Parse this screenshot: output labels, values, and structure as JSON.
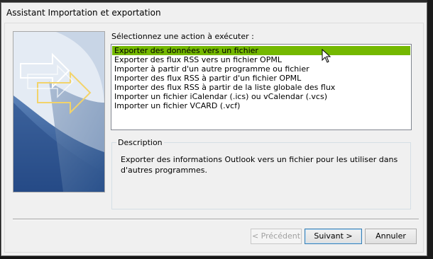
{
  "window": {
    "title": "Assistant Importation et exportation"
  },
  "prompt": "Sélectionnez une action à exécuter :",
  "actions": [
    "Exporter des données vers un fichier",
    "Exporter des flux RSS vers un fichier OPML",
    "Importer à partir d'un autre programme ou fichier",
    "Importer des flux RSS à partir d'un fichier OPML",
    "Importer des flux RSS à partir de la liste globale des flux",
    "Importer un fichier iCalendar (.ics) ou vCalendar (.vcs)",
    "Importer un fichier VCARD (.vcf)"
  ],
  "selected_index": 0,
  "description": {
    "title": "Description",
    "text": "Exporter des informations Outlook vers un fichier pour les utiliser dans d'autres programmes."
  },
  "buttons": {
    "previous": "< Précédent",
    "next": "Suivant >",
    "cancel": "Annuler"
  },
  "colors": {
    "selection": "#74b800",
    "default_button_border": "#3c7fb1"
  }
}
